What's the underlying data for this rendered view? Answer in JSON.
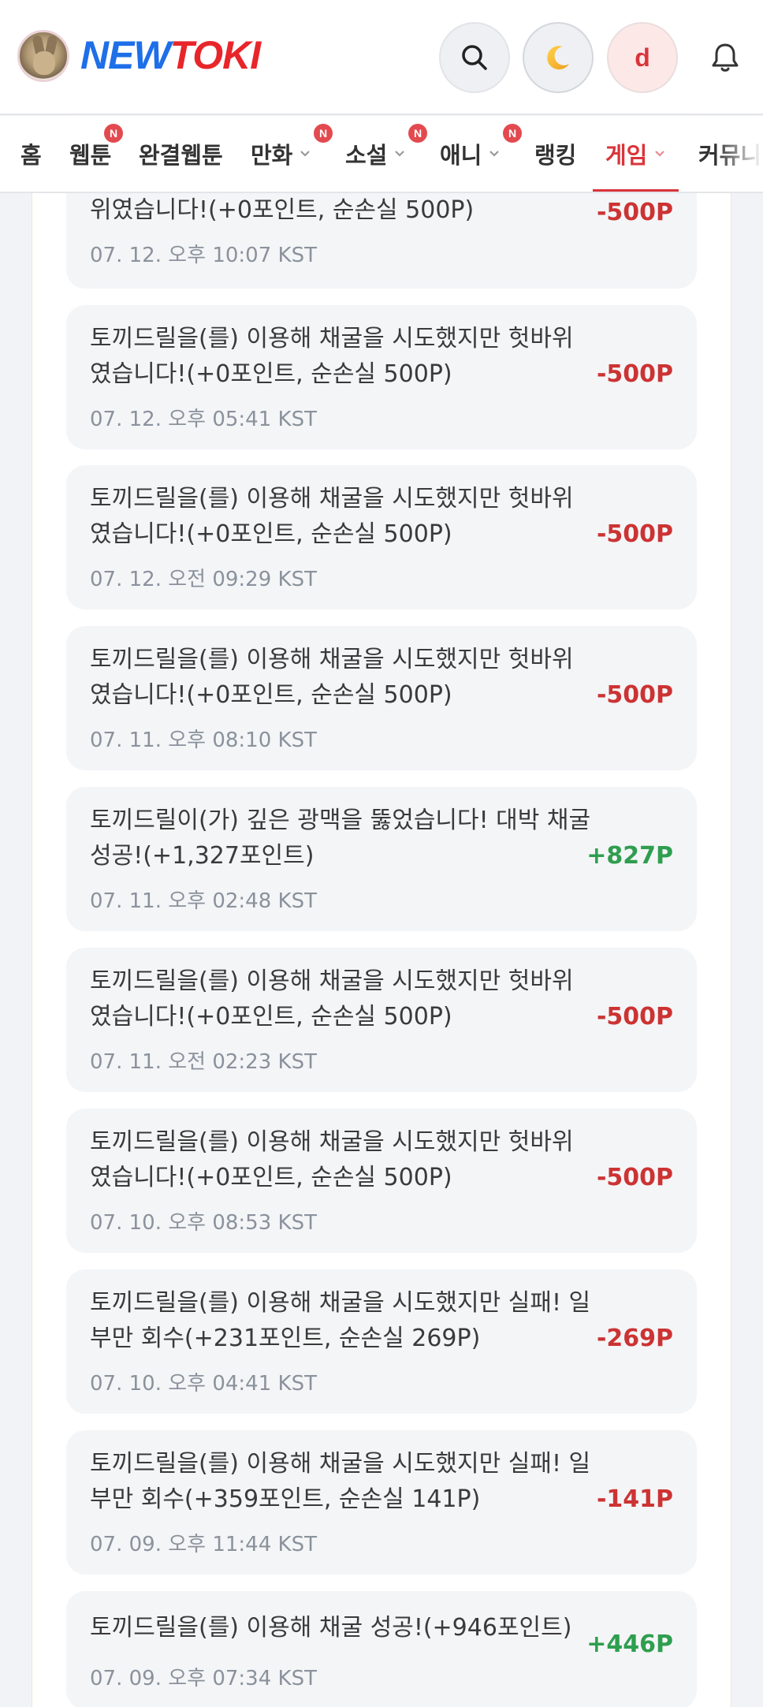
{
  "header": {
    "logo_left": "NEW",
    "logo_right": "TOKI",
    "user_initial": "d",
    "icons": {
      "search": "search-icon",
      "theme": "moon-icon",
      "notifications": "bell-icon"
    }
  },
  "nav": {
    "items": [
      {
        "label": "홈",
        "badge": "",
        "dropdown": false,
        "active": false
      },
      {
        "label": "웹툰",
        "badge": "N",
        "dropdown": false,
        "active": false
      },
      {
        "label": "완결웹툰",
        "badge": "",
        "dropdown": false,
        "active": false
      },
      {
        "label": "만화",
        "badge": "N",
        "dropdown": true,
        "active": false
      },
      {
        "label": "소설",
        "badge": "N",
        "dropdown": true,
        "active": false
      },
      {
        "label": "애니",
        "badge": "N",
        "dropdown": true,
        "active": false
      },
      {
        "label": "랭킹",
        "badge": "",
        "dropdown": false,
        "active": false
      },
      {
        "label": "게임",
        "badge": "",
        "dropdown": true,
        "active": true
      },
      {
        "label": "커뮤니",
        "badge": "",
        "dropdown": false,
        "active": false
      }
    ]
  },
  "colors": {
    "accent": "#d9343a",
    "negative": "#cc3333",
    "positive": "#2e9e4f",
    "logo_blue": "#1e6fe8",
    "logo_red": "#e8262a"
  },
  "history": [
    {
      "desc": "위였습니다!(+0포인트, 순손실 500P)",
      "time": "07. 12. 오후 10:07 KST",
      "amount": "-500P",
      "type": "neg"
    },
    {
      "desc": "토끼드릴을(를) 이용해 채굴을 시도했지만 헛바위였습니다!(+0포인트, 순손실 500P)",
      "time": "07. 12. 오후 05:41 KST",
      "amount": "-500P",
      "type": "neg"
    },
    {
      "desc": "토끼드릴을(를) 이용해 채굴을 시도했지만 헛바위였습니다!(+0포인트, 순손실 500P)",
      "time": "07. 12. 오전 09:29 KST",
      "amount": "-500P",
      "type": "neg"
    },
    {
      "desc": "토끼드릴을(를) 이용해 채굴을 시도했지만 헛바위였습니다!(+0포인트, 순손실 500P)",
      "time": "07. 11. 오후 08:10 KST",
      "amount": "-500P",
      "type": "neg"
    },
    {
      "desc": "토끼드릴이(가) 깊은 광맥을 뚫었습니다! 대박 채굴 성공!(+1,327포인트)",
      "time": "07. 11. 오후 02:48 KST",
      "amount": "+827P",
      "type": "pos"
    },
    {
      "desc": "토끼드릴을(를) 이용해 채굴을 시도했지만 헛바위였습니다!(+0포인트, 순손실 500P)",
      "time": "07. 11. 오전 02:23 KST",
      "amount": "-500P",
      "type": "neg"
    },
    {
      "desc": "토끼드릴을(를) 이용해 채굴을 시도했지만 헛바위였습니다!(+0포인트, 순손실 500P)",
      "time": "07. 10. 오후 08:53 KST",
      "amount": "-500P",
      "type": "neg"
    },
    {
      "desc": "토끼드릴을(를) 이용해 채굴을 시도했지만 실패! 일부만 회수(+231포인트, 순손실 269P)",
      "time": "07. 10. 오후 04:41 KST",
      "amount": "-269P",
      "type": "neg"
    },
    {
      "desc": "토끼드릴을(를) 이용해 채굴을 시도했지만 실패! 일부만 회수(+359포인트, 순손실 141P)",
      "time": "07. 09. 오후 11:44 KST",
      "amount": "-141P",
      "type": "neg"
    },
    {
      "desc": "토끼드릴을(를) 이용해 채굴 성공!(+946포인트)",
      "time": "07. 09. 오후 07:34 KST",
      "amount": "+446P",
      "type": "pos"
    }
  ]
}
